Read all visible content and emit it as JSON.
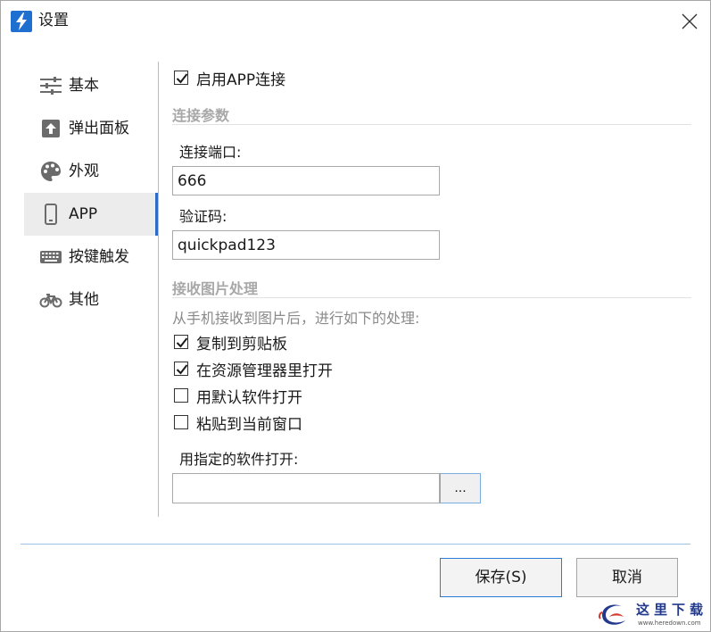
{
  "window": {
    "title": "设置"
  },
  "sidebar": {
    "items": [
      {
        "label": "基本",
        "icon": "sliders-icon",
        "active": false
      },
      {
        "label": "弹出面板",
        "icon": "arrow-up-box-icon",
        "active": false
      },
      {
        "label": "外观",
        "icon": "palette-icon",
        "active": false
      },
      {
        "label": "APP",
        "icon": "phone-icon",
        "active": true
      },
      {
        "label": "按键触发",
        "icon": "keyboard-icon",
        "active": false
      },
      {
        "label": "其他",
        "icon": "bicycle-icon",
        "active": false
      }
    ]
  },
  "app": {
    "enable_label": "启用APP连接",
    "enable_checked": true,
    "connection_section": "连接参数",
    "port_label": "连接端口:",
    "port_value": "666",
    "code_label": "验证码:",
    "code_value": "quickpad123",
    "image_section": "接收图片处理",
    "image_hint": "从手机接收到图片后，进行如下的处理:",
    "options": [
      {
        "label": "复制到剪贴板",
        "checked": true
      },
      {
        "label": "在资源管理器里打开",
        "checked": true
      },
      {
        "label": "用默认软件打开",
        "checked": false
      },
      {
        "label": "粘贴到当前窗口",
        "checked": false
      }
    ],
    "software_label": "用指定的软件打开:",
    "software_value": "",
    "browse_label": "..."
  },
  "footer": {
    "save_label": "保存(S)",
    "cancel_label": "取消"
  },
  "watermark": {
    "text": "这里下载",
    "url": "www.heredown.com"
  },
  "colors": {
    "accent": "#2b6cc4",
    "divider": "#9cc2e6",
    "section_text": "#a8a8a8"
  }
}
